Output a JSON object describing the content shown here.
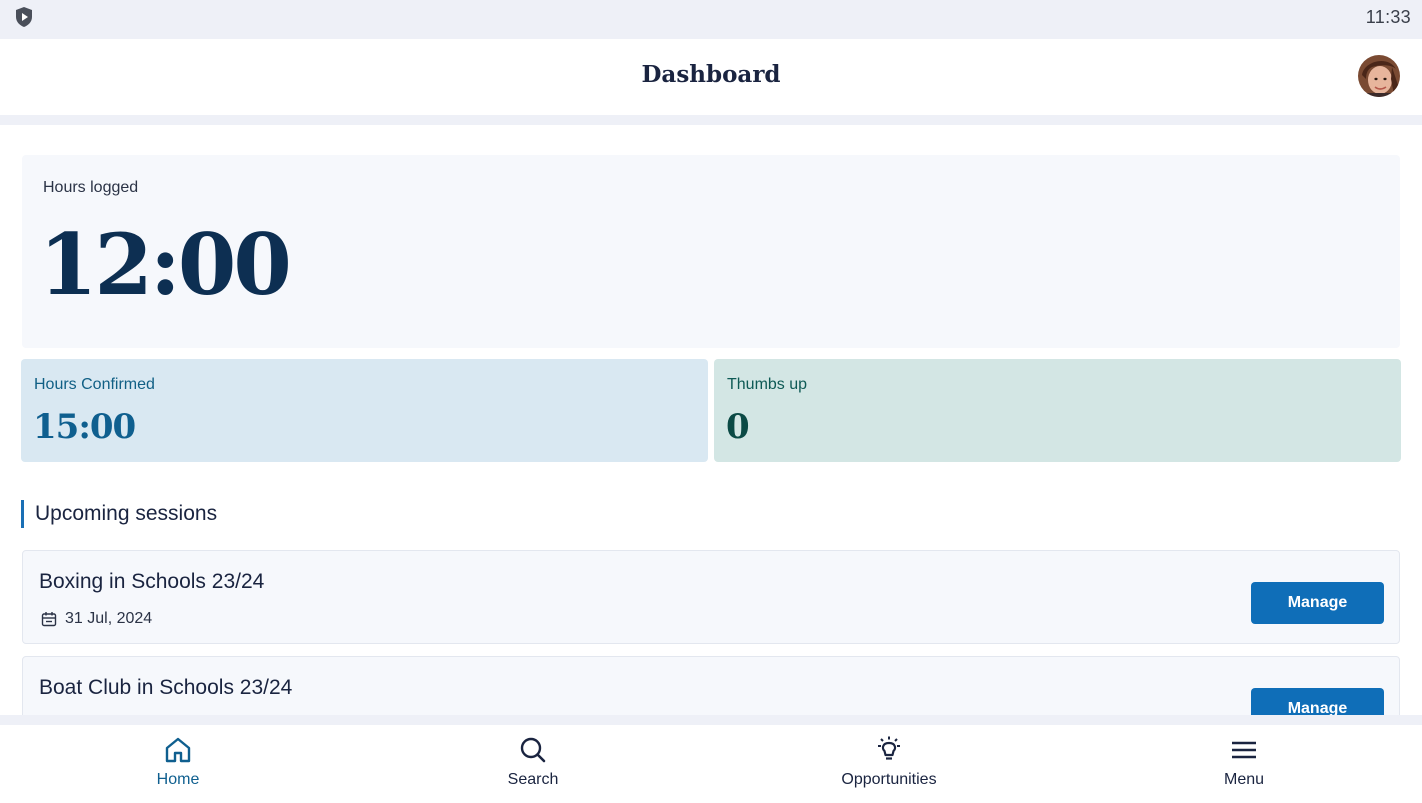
{
  "status_bar": {
    "time": "11:33",
    "icon": "shield-play-icon"
  },
  "header": {
    "title": "Dashboard",
    "avatar": "user-avatar"
  },
  "hours_logged": {
    "label": "Hours logged",
    "value": "12:00"
  },
  "stats": {
    "hours_confirmed": {
      "label": "Hours Confirmed",
      "value": "15:00"
    },
    "thumbs_up": {
      "label": "Thumbs up",
      "value": "0"
    }
  },
  "upcoming": {
    "heading": "Upcoming sessions",
    "sessions": [
      {
        "title": "Boxing in Schools 23/24",
        "date": "31 Jul, 2024",
        "action": "Manage"
      },
      {
        "title": "Boat Club in Schools 23/24",
        "date": "",
        "action": "Manage"
      }
    ]
  },
  "nav": {
    "items": [
      {
        "label": "Home",
        "icon": "home-icon",
        "active": true
      },
      {
        "label": "Search",
        "icon": "search-icon",
        "active": false
      },
      {
        "label": "Opportunities",
        "icon": "lightbulb-icon",
        "active": false
      },
      {
        "label": "Menu",
        "icon": "hamburger-menu-icon",
        "active": false
      }
    ]
  },
  "colors": {
    "primary": "#0f6eb8",
    "navy": "#1a2440",
    "confirmed_bg": "#d9e8f2",
    "thumbs_bg": "#d3e6e4",
    "card_bg": "#f6f8fc"
  }
}
